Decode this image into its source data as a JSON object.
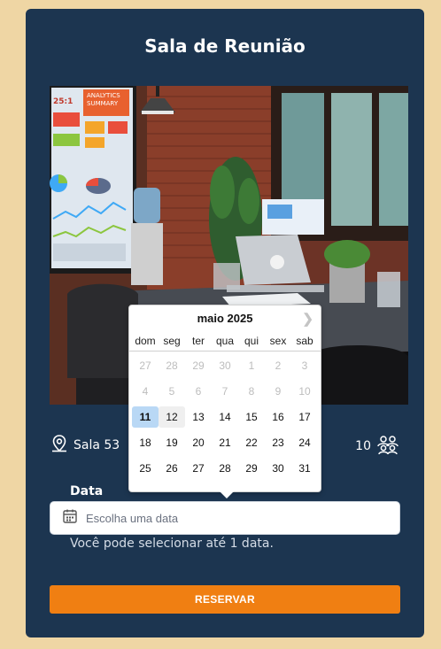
{
  "card": {
    "title": "Sala de Reunião"
  },
  "room": {
    "name": "Sala 53",
    "capacity": "10",
    "location_icon": "location-pin-icon",
    "capacity_icon": "people-group-icon"
  },
  "date_field": {
    "label": "Data",
    "placeholder": "Escolha uma data",
    "helper": "Você pode selecionar até 1 data.",
    "icon": "calendar-icon"
  },
  "reserve_button": {
    "label": "RESERVAR"
  },
  "calendar": {
    "month_label": "maio 2025",
    "weekdays": [
      "dom",
      "seg",
      "ter",
      "qua",
      "qui",
      "sex",
      "sab"
    ],
    "days": [
      {
        "d": "27",
        "muted": true
      },
      {
        "d": "28",
        "muted": true
      },
      {
        "d": "29",
        "muted": true
      },
      {
        "d": "30",
        "muted": true
      },
      {
        "d": "1",
        "muted": true
      },
      {
        "d": "2",
        "muted": true
      },
      {
        "d": "3",
        "muted": true
      },
      {
        "d": "4",
        "muted": true
      },
      {
        "d": "5",
        "muted": true
      },
      {
        "d": "6",
        "muted": true
      },
      {
        "d": "7",
        "muted": true
      },
      {
        "d": "8",
        "muted": true
      },
      {
        "d": "9",
        "muted": true
      },
      {
        "d": "10",
        "muted": true
      },
      {
        "d": "11",
        "selected": true
      },
      {
        "d": "12",
        "hover": true
      },
      {
        "d": "13"
      },
      {
        "d": "14"
      },
      {
        "d": "15"
      },
      {
        "d": "16"
      },
      {
        "d": "17"
      },
      {
        "d": "18"
      },
      {
        "d": "19"
      },
      {
        "d": "20"
      },
      {
        "d": "21"
      },
      {
        "d": "22"
      },
      {
        "d": "23"
      },
      {
        "d": "24"
      },
      {
        "d": "25"
      },
      {
        "d": "26"
      },
      {
        "d": "27"
      },
      {
        "d": "28"
      },
      {
        "d": "29"
      },
      {
        "d": "30"
      },
      {
        "d": "31"
      }
    ],
    "next_icon": "chevron-right-icon"
  },
  "photo": {
    "screen_lines": [
      "ANALYTICS",
      "SUMMARY",
      "25:1"
    ]
  },
  "colors": {
    "page_bg": "#efd6a4",
    "card_bg": "#1c3550",
    "accent": "#f07f12",
    "selected_day": "#b9d8f5"
  }
}
